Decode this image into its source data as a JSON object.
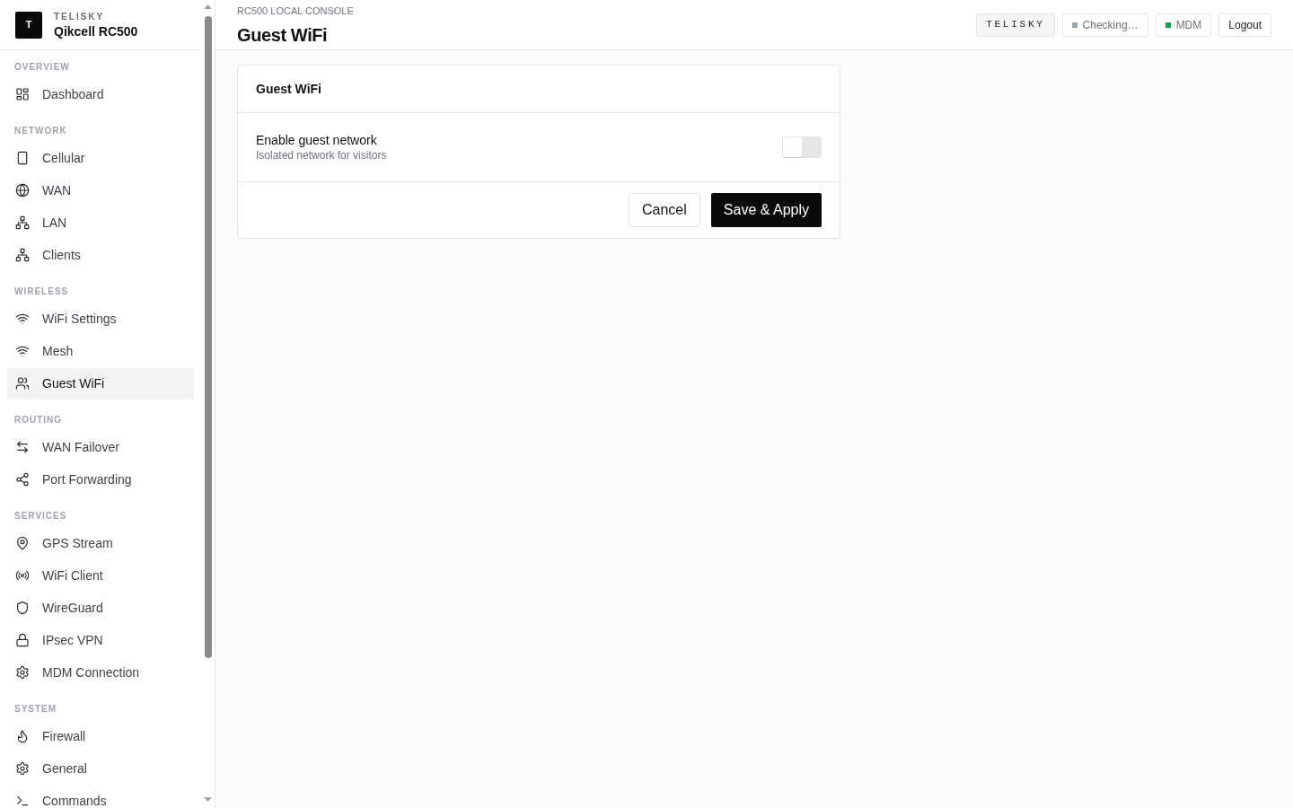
{
  "sidebar": {
    "brand": {
      "logo": "T",
      "company": "TELISKY",
      "product": "Qikcell RC500"
    },
    "sections": [
      {
        "title": "OVERVIEW",
        "items": [
          {
            "label": "Dashboard",
            "selected": false
          }
        ]
      },
      {
        "title": "NETWORK",
        "items": [
          {
            "label": "Cellular",
            "selected": false
          },
          {
            "label": "WAN",
            "selected": false
          },
          {
            "label": "LAN",
            "selected": false
          },
          {
            "label": "Clients",
            "selected": false
          }
        ]
      },
      {
        "title": "WIRELESS",
        "items": [
          {
            "label": "WiFi Settings",
            "selected": false
          },
          {
            "label": "Mesh",
            "selected": false
          },
          {
            "label": "Guest WiFi",
            "selected": true
          }
        ]
      },
      {
        "title": "ROUTING",
        "items": [
          {
            "label": "WAN Failover",
            "selected": false
          },
          {
            "label": "Port Forwarding",
            "selected": false
          }
        ]
      },
      {
        "title": "SERVICES",
        "items": [
          {
            "label": "GPS Stream",
            "selected": false
          },
          {
            "label": "WiFi Client",
            "selected": false
          },
          {
            "label": "WireGuard",
            "selected": false
          },
          {
            "label": "IPsec VPN",
            "selected": false
          },
          {
            "label": "MDM Connection",
            "selected": false
          }
        ]
      },
      {
        "title": "SYSTEM",
        "items": [
          {
            "label": "Firewall",
            "selected": false
          },
          {
            "label": "General",
            "selected": false
          },
          {
            "label": "Commands",
            "selected": false
          }
        ]
      }
    ]
  },
  "topbar": {
    "eyebrow": "RC500 LOCAL CONSOLE",
    "title": "Guest WiFi",
    "badges": [
      {
        "kind": "brand",
        "label": "TELISKY"
      },
      {
        "kind": "status",
        "label": "Checking…",
        "color": "#9ca3af"
      },
      {
        "kind": "status",
        "label": "MDM",
        "color": "#16a34a"
      },
      {
        "kind": "button",
        "label": "Logout"
      }
    ]
  },
  "card": {
    "title": "Guest WiFi",
    "settings": [
      {
        "label": "Enable guest network",
        "description": "Isolated network for visitors",
        "on": false
      }
    ],
    "buttons": [
      {
        "kind": "secondary",
        "label": "Cancel"
      },
      {
        "kind": "primary",
        "label": "Save & Apply"
      }
    ]
  }
}
